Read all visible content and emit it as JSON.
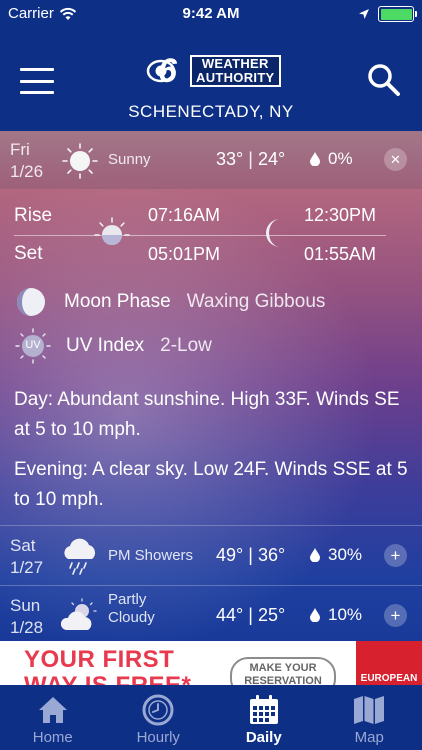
{
  "status_bar": {
    "carrier": "Carrier",
    "time": "9:42 AM"
  },
  "header": {
    "logo_number": "6",
    "logo_line1": "WEATHER",
    "logo_line2": "AUTHORITY",
    "location": "SCHENECTADY, NY"
  },
  "selected_day": {
    "day": "Fri",
    "date": "1/26",
    "icon": "sun-icon",
    "condition": "Sunny",
    "high": "33°",
    "low": "24°",
    "precip": "0%",
    "rise_label": "Rise",
    "set_label": "Set",
    "sunrise": "07:16AM",
    "sunset": "05:01PM",
    "moonrise": "12:30PM",
    "moonset": "01:55AM",
    "moon_phase_label": "Moon Phase",
    "moon_phase": "Waxing Gibbous",
    "uv_label": "UV Index",
    "uv_icon_text": "UV",
    "uv_value": "2-Low",
    "day_text": "Day: Abundant sunshine. High 33F. Winds SE at 5 to 10 mph.",
    "evening_text": "Evening: A clear sky. Low 24F. Winds SSE at 5 to 10 mph.",
    "close_glyph": "✕"
  },
  "days": [
    {
      "day": "Sat",
      "date": "1/27",
      "icon": "showers-icon",
      "condition": "PM Showers",
      "high": "49°",
      "low": "36°",
      "precip": "30%",
      "expand_glyph": "+"
    },
    {
      "day": "Sun",
      "date": "1/28",
      "icon": "partly-cloudy-icon",
      "condition": "Partly Cloudy",
      "high": "44°",
      "low": "25°",
      "precip": "10%",
      "expand_glyph": "+"
    }
  ],
  "ad": {
    "headline": "YOUR FIRST WAY IS FREE*",
    "cta": "MAKE YOUR RESERVATION",
    "side": "EUROPEAN"
  },
  "tabs": [
    {
      "label": "Home",
      "icon": "home-icon",
      "active": false
    },
    {
      "label": "Hourly",
      "icon": "clock-icon",
      "active": false
    },
    {
      "label": "Daily",
      "icon": "calendar-icon",
      "active": true
    },
    {
      "label": "Map",
      "icon": "map-icon",
      "active": false
    }
  ],
  "colors": {
    "header_bg": "#0d2f86",
    "battery": "#4cd964",
    "ad_red": "#e8394f"
  }
}
